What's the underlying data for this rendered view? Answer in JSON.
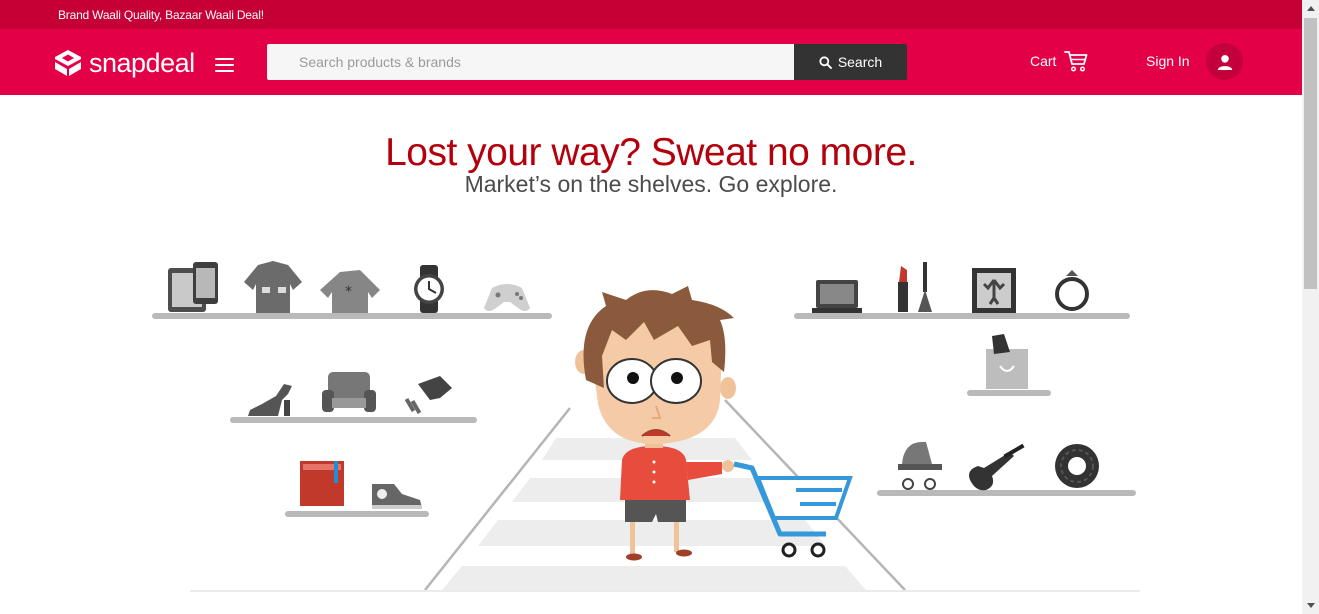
{
  "topbar": {
    "tagline": "Brand Waali Quality, Bazaar Waali Deal!"
  },
  "header": {
    "logo_text": "snapdeal",
    "search": {
      "placeholder": "Search products & brands",
      "value": "",
      "button_label": "Search"
    },
    "cart_label": "Cart",
    "signin_label": "Sign In"
  },
  "main": {
    "headline": "Lost your way? Sweat no more.",
    "subheadline": "Market’s on the shelves. Go explore."
  },
  "colors": {
    "brand": "#e40046",
    "brand_dark": "#c50035",
    "search_button": "#333333",
    "headline": "#b3000c"
  },
  "icons": [
    "menu-icon",
    "search-icon",
    "cart-icon",
    "user-icon",
    "scroll-up-arrow",
    "scroll-down-arrow"
  ]
}
